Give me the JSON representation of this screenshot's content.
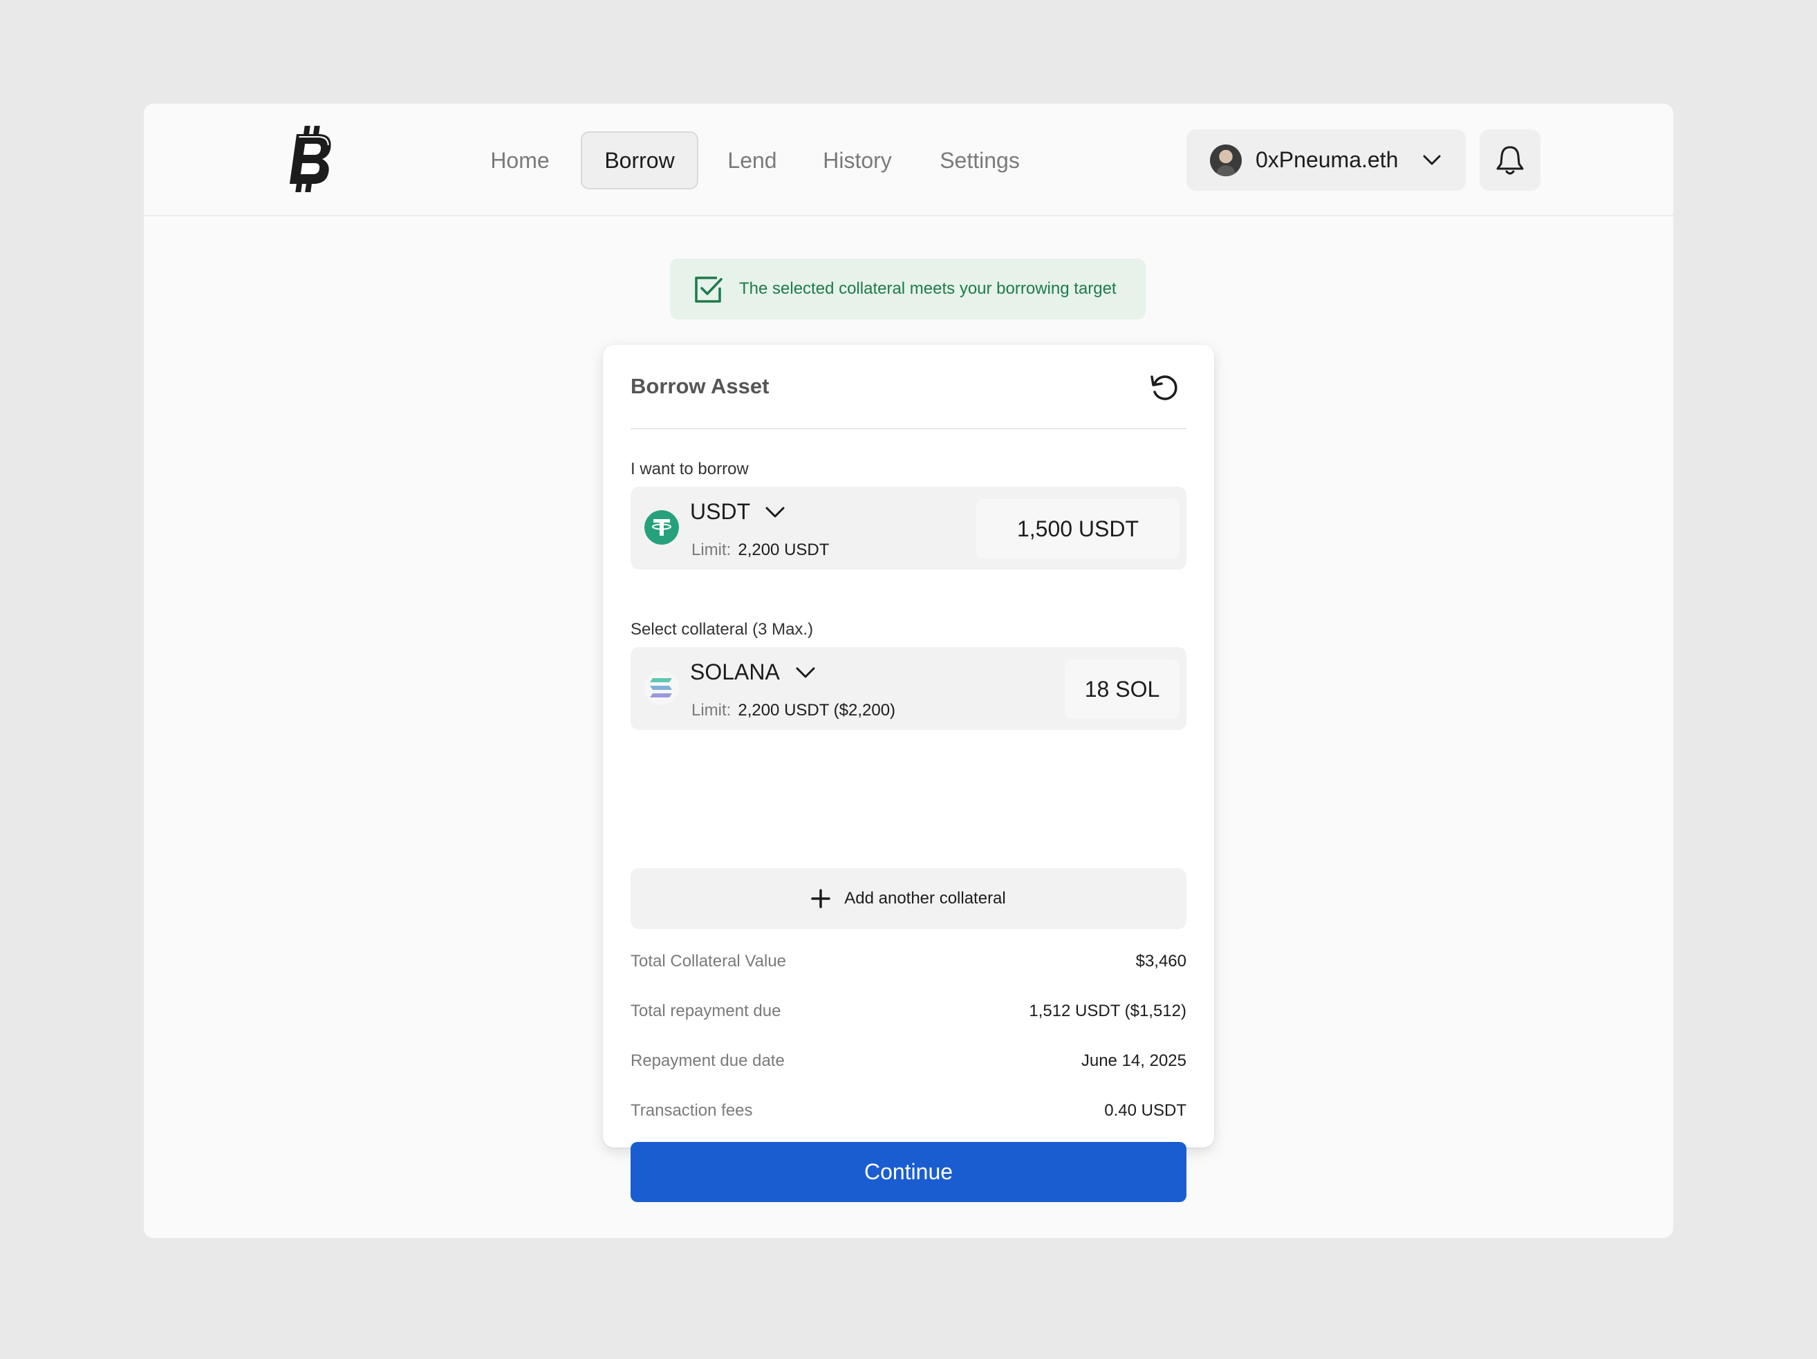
{
  "nav": {
    "items": [
      {
        "label": "Home",
        "active": false
      },
      {
        "label": "Borrow",
        "active": true
      },
      {
        "label": "Lend",
        "active": false
      },
      {
        "label": "History",
        "active": false
      },
      {
        "label": "Settings",
        "active": false
      }
    ]
  },
  "user": {
    "name": "0xPneuma.eth"
  },
  "banner": {
    "text": "The selected collateral meets your borrowing target"
  },
  "card": {
    "title": "Borrow Asset",
    "borrow": {
      "label": "I want to borrow",
      "asset": "USDT",
      "limit_label": "Limit:",
      "limit_value": "2,200 USDT",
      "amount": "1,500 USDT"
    },
    "collateral": {
      "label": "Select collateral (3 Max.)",
      "asset": "SOLANA",
      "limit_label": "Limit:",
      "limit_value": "2,200 USDT ($2,200)",
      "amount": "18 SOL"
    },
    "add_collateral": "Add another collateral",
    "summary": [
      {
        "key": "Total Collateral Value",
        "value": "$3,460"
      },
      {
        "key": "Total repayment due",
        "value": "1,512 USDT ($1,512)"
      },
      {
        "key": "Repayment due date",
        "value": "June 14, 2025"
      },
      {
        "key": "Transaction fees",
        "value": "0.40 USDT"
      }
    ],
    "continue_label": "Continue"
  },
  "colors": {
    "accent": "#1a5dd0",
    "success_bg": "#e6f2ea",
    "success_text": "#1f7a4a",
    "tether": "#26a17b"
  },
  "icons": {
    "logo": "bitcoin-logo-icon",
    "user_chevron": "chevron-down-icon",
    "bell": "bell-icon",
    "banner_check": "checkbox-check-icon",
    "refresh": "refresh-icon",
    "usdt": "tether-icon",
    "solana": "solana-icon",
    "add": "plus-icon"
  }
}
